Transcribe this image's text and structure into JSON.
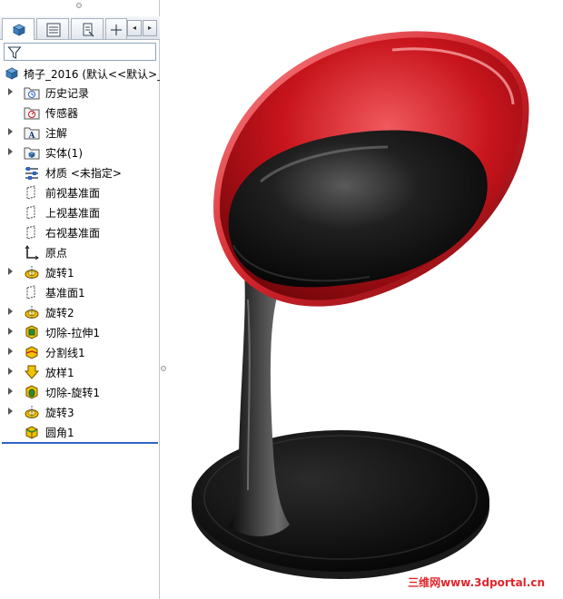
{
  "tabs": [
    {
      "name": "feature-manager",
      "icon": "feature-manager-icon",
      "active": true
    },
    {
      "name": "property-manager",
      "icon": "property-manager-icon",
      "active": false
    },
    {
      "name": "configuration-manager",
      "icon": "configuration-manager-icon",
      "active": false
    },
    {
      "name": "dim-xpert",
      "icon": "crosshair-icon",
      "active": false
    }
  ],
  "tab_scroll": {
    "left": "◂",
    "right": "▸"
  },
  "filter": {
    "icon": "filter-icon",
    "value": ""
  },
  "tree": {
    "root_label": "椅子_2016 (默认<<默认>_",
    "items": [
      {
        "label": "历史记录",
        "icon": "history-folder-icon",
        "expandable": true
      },
      {
        "label": "传感器",
        "icon": "sensor-folder-icon",
        "expandable": false
      },
      {
        "label": "注解",
        "icon": "annotation-folder-icon",
        "expandable": true
      },
      {
        "label": "实体(1)",
        "icon": "solid-bodies-folder-icon",
        "expandable": true
      },
      {
        "label": "材质 <未指定>",
        "icon": "material-icon",
        "expandable": false
      },
      {
        "label": "前视基准面",
        "icon": "plane-icon",
        "expandable": false
      },
      {
        "label": "上视基准面",
        "icon": "plane-icon",
        "expandable": false
      },
      {
        "label": "右视基准面",
        "icon": "plane-icon",
        "expandable": false
      },
      {
        "label": "原点",
        "icon": "origin-icon",
        "expandable": false
      },
      {
        "label": "旋转1",
        "icon": "revolve-icon",
        "expandable": true
      },
      {
        "label": "基准面1",
        "icon": "plane-icon",
        "expandable": false
      },
      {
        "label": "旋转2",
        "icon": "revolve-icon",
        "expandable": true
      },
      {
        "label": "切除-拉伸1",
        "icon": "cut-extrude-icon",
        "expandable": true
      },
      {
        "label": "分割线1",
        "icon": "split-line-icon",
        "expandable": true
      },
      {
        "label": "放样1",
        "icon": "loft-icon",
        "expandable": true
      },
      {
        "label": "切除-旋转1",
        "icon": "cut-revolve-icon",
        "expandable": true
      },
      {
        "label": "旋转3",
        "icon": "revolve-icon",
        "expandable": true
      },
      {
        "label": "圆角1",
        "icon": "fillet-icon",
        "expandable": false
      }
    ]
  },
  "colors": {
    "shell_red": "#c8141c",
    "seat_black": "#141414",
    "rollback_blue": "#2f63c6",
    "watermark_red": "#e0262c"
  },
  "watermark": "三维网www.3dportal.cn"
}
